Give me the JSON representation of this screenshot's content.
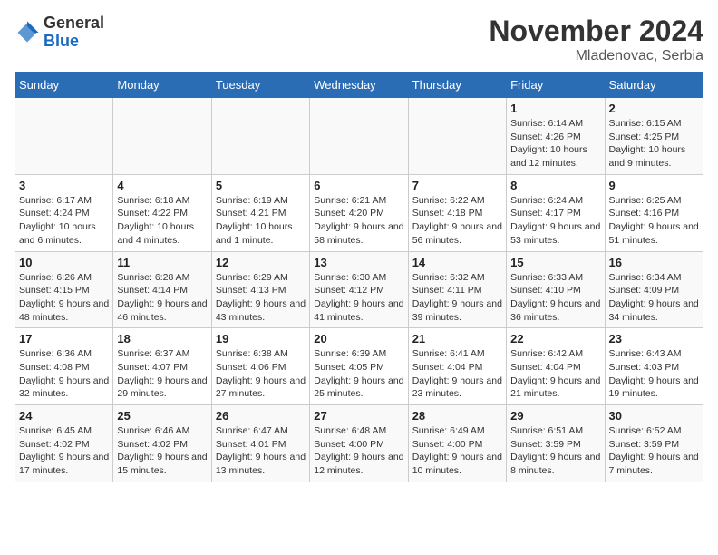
{
  "logo": {
    "general": "General",
    "blue": "Blue"
  },
  "title": "November 2024",
  "subtitle": "Mladenovac, Serbia",
  "days_header": [
    "Sunday",
    "Monday",
    "Tuesday",
    "Wednesday",
    "Thursday",
    "Friday",
    "Saturday"
  ],
  "weeks": [
    [
      {
        "day": "",
        "info": ""
      },
      {
        "day": "",
        "info": ""
      },
      {
        "day": "",
        "info": ""
      },
      {
        "day": "",
        "info": ""
      },
      {
        "day": "",
        "info": ""
      },
      {
        "day": "1",
        "info": "Sunrise: 6:14 AM\nSunset: 4:26 PM\nDaylight: 10 hours and 12 minutes."
      },
      {
        "day": "2",
        "info": "Sunrise: 6:15 AM\nSunset: 4:25 PM\nDaylight: 10 hours and 9 minutes."
      }
    ],
    [
      {
        "day": "3",
        "info": "Sunrise: 6:17 AM\nSunset: 4:24 PM\nDaylight: 10 hours and 6 minutes."
      },
      {
        "day": "4",
        "info": "Sunrise: 6:18 AM\nSunset: 4:22 PM\nDaylight: 10 hours and 4 minutes."
      },
      {
        "day": "5",
        "info": "Sunrise: 6:19 AM\nSunset: 4:21 PM\nDaylight: 10 hours and 1 minute."
      },
      {
        "day": "6",
        "info": "Sunrise: 6:21 AM\nSunset: 4:20 PM\nDaylight: 9 hours and 58 minutes."
      },
      {
        "day": "7",
        "info": "Sunrise: 6:22 AM\nSunset: 4:18 PM\nDaylight: 9 hours and 56 minutes."
      },
      {
        "day": "8",
        "info": "Sunrise: 6:24 AM\nSunset: 4:17 PM\nDaylight: 9 hours and 53 minutes."
      },
      {
        "day": "9",
        "info": "Sunrise: 6:25 AM\nSunset: 4:16 PM\nDaylight: 9 hours and 51 minutes."
      }
    ],
    [
      {
        "day": "10",
        "info": "Sunrise: 6:26 AM\nSunset: 4:15 PM\nDaylight: 9 hours and 48 minutes."
      },
      {
        "day": "11",
        "info": "Sunrise: 6:28 AM\nSunset: 4:14 PM\nDaylight: 9 hours and 46 minutes."
      },
      {
        "day": "12",
        "info": "Sunrise: 6:29 AM\nSunset: 4:13 PM\nDaylight: 9 hours and 43 minutes."
      },
      {
        "day": "13",
        "info": "Sunrise: 6:30 AM\nSunset: 4:12 PM\nDaylight: 9 hours and 41 minutes."
      },
      {
        "day": "14",
        "info": "Sunrise: 6:32 AM\nSunset: 4:11 PM\nDaylight: 9 hours and 39 minutes."
      },
      {
        "day": "15",
        "info": "Sunrise: 6:33 AM\nSunset: 4:10 PM\nDaylight: 9 hours and 36 minutes."
      },
      {
        "day": "16",
        "info": "Sunrise: 6:34 AM\nSunset: 4:09 PM\nDaylight: 9 hours and 34 minutes."
      }
    ],
    [
      {
        "day": "17",
        "info": "Sunrise: 6:36 AM\nSunset: 4:08 PM\nDaylight: 9 hours and 32 minutes."
      },
      {
        "day": "18",
        "info": "Sunrise: 6:37 AM\nSunset: 4:07 PM\nDaylight: 9 hours and 29 minutes."
      },
      {
        "day": "19",
        "info": "Sunrise: 6:38 AM\nSunset: 4:06 PM\nDaylight: 9 hours and 27 minutes."
      },
      {
        "day": "20",
        "info": "Sunrise: 6:39 AM\nSunset: 4:05 PM\nDaylight: 9 hours and 25 minutes."
      },
      {
        "day": "21",
        "info": "Sunrise: 6:41 AM\nSunset: 4:04 PM\nDaylight: 9 hours and 23 minutes."
      },
      {
        "day": "22",
        "info": "Sunrise: 6:42 AM\nSunset: 4:04 PM\nDaylight: 9 hours and 21 minutes."
      },
      {
        "day": "23",
        "info": "Sunrise: 6:43 AM\nSunset: 4:03 PM\nDaylight: 9 hours and 19 minutes."
      }
    ],
    [
      {
        "day": "24",
        "info": "Sunrise: 6:45 AM\nSunset: 4:02 PM\nDaylight: 9 hours and 17 minutes."
      },
      {
        "day": "25",
        "info": "Sunrise: 6:46 AM\nSunset: 4:02 PM\nDaylight: 9 hours and 15 minutes."
      },
      {
        "day": "26",
        "info": "Sunrise: 6:47 AM\nSunset: 4:01 PM\nDaylight: 9 hours and 13 minutes."
      },
      {
        "day": "27",
        "info": "Sunrise: 6:48 AM\nSunset: 4:00 PM\nDaylight: 9 hours and 12 minutes."
      },
      {
        "day": "28",
        "info": "Sunrise: 6:49 AM\nSunset: 4:00 PM\nDaylight: 9 hours and 10 minutes."
      },
      {
        "day": "29",
        "info": "Sunrise: 6:51 AM\nSunset: 3:59 PM\nDaylight: 9 hours and 8 minutes."
      },
      {
        "day": "30",
        "info": "Sunrise: 6:52 AM\nSunset: 3:59 PM\nDaylight: 9 hours and 7 minutes."
      }
    ]
  ]
}
